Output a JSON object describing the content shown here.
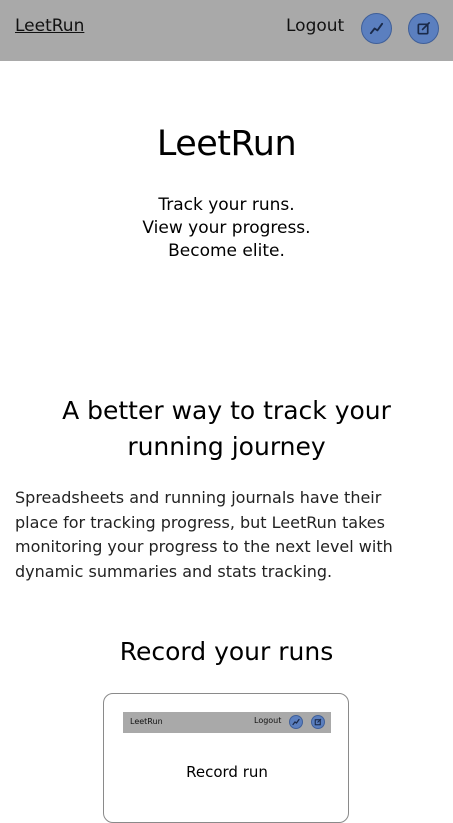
{
  "navbar": {
    "brand": "LeetRun",
    "logout": "Logout",
    "stats_icon": "line-chart-icon",
    "record_icon": "edit-square-icon",
    "background": "#a9a9a9",
    "icon_color": "#5b7fbf"
  },
  "hero": {
    "title": "LeetRun",
    "tagline": [
      "Track your runs.",
      "View your progress.",
      "Become elite."
    ]
  },
  "feature": {
    "title": "A better way to track your running journey",
    "body": "Spreadsheets and running journals have their place for tracking progress, but LeetRun takes monitoring your progress to the next level with dynamic summaries and stats tracking."
  },
  "record_section": {
    "title": "Record your runs",
    "preview": {
      "brand": "LeetRun",
      "logout": "Logout",
      "heading": "Record run"
    }
  }
}
